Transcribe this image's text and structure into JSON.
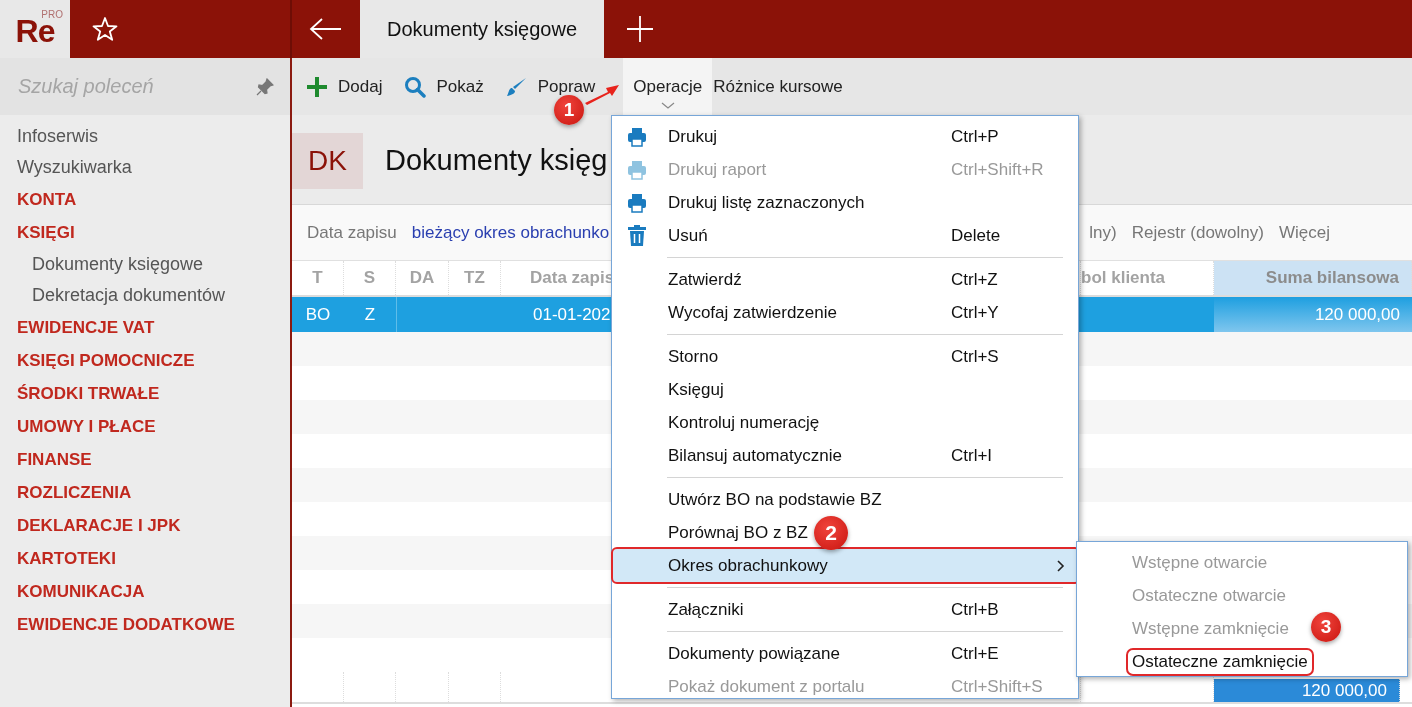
{
  "logo": {
    "text": "Re",
    "badge": "PRO"
  },
  "tabs": [
    {
      "label": "Dokumenty księgowe",
      "selected": true
    }
  ],
  "sidebar": {
    "search": {
      "placeholder": "Szukaj poleceń"
    },
    "items": [
      {
        "label": "Infoserwis",
        "kind": "link"
      },
      {
        "label": "Wyszukiwarka",
        "kind": "link"
      },
      {
        "label": "KONTA",
        "kind": "section"
      },
      {
        "label": "KSIĘGI",
        "kind": "section",
        "children": [
          {
            "label": "Dokumenty księgowe",
            "kind": "link"
          },
          {
            "label": "Dekretacja dokumentów",
            "kind": "link"
          }
        ]
      },
      {
        "label": "EWIDENCJE VAT",
        "kind": "section"
      },
      {
        "label": "KSIĘGI POMOCNICZE",
        "kind": "section"
      },
      {
        "label": "ŚRODKI TRWAŁE",
        "kind": "section"
      },
      {
        "label": "UMOWY I PŁACE",
        "kind": "section"
      },
      {
        "label": "FINANSE",
        "kind": "section"
      },
      {
        "label": "ROZLICZENIA",
        "kind": "section"
      },
      {
        "label": "DEKLARACJE I JPK",
        "kind": "section"
      },
      {
        "label": "KARTOTEKI",
        "kind": "section"
      },
      {
        "label": "KOMUNIKACJA",
        "kind": "section"
      },
      {
        "label": "EWIDENCJE DODATKOWE",
        "kind": "section"
      }
    ]
  },
  "toolbar": [
    {
      "label": "Dodaj",
      "kind": "add",
      "selected": false
    },
    {
      "label": "Pokaż",
      "kind": "show",
      "selected": false
    },
    {
      "label": "Popraw",
      "kind": "edit",
      "selected": false
    },
    {
      "label": "Operacje",
      "kind": "menu",
      "selected": true,
      "marker": "1"
    },
    {
      "label": "Różnice kursowe",
      "kind": "plain",
      "selected": false
    }
  ],
  "header": {
    "badge": "DK",
    "title": "Dokumenty księg"
  },
  "filters": [
    {
      "text": "Data zapisu",
      "kind": "label"
    },
    {
      "text": "bieżący okres obrachunko",
      "kind": "value"
    },
    {
      "text": "lny)",
      "kind": "label"
    },
    {
      "text": "Rejestr (dowolny)",
      "kind": "label"
    },
    {
      "text": "Więcej",
      "kind": "label"
    }
  ],
  "table": {
    "columns": [
      {
        "label": "T",
        "selected": false
      },
      {
        "label": "S",
        "selected": false
      },
      {
        "label": "DA",
        "selected": false
      },
      {
        "label": "TZ",
        "selected": false
      },
      {
        "label": "Data zapis",
        "selected": false
      },
      {
        "label": "bol klienta",
        "selected": false
      },
      {
        "label": "Suma bilansowa",
        "selected": true
      }
    ],
    "rows": [
      {
        "selected": true,
        "cells": [
          "BO",
          "Z",
          null,
          null,
          "01-01-202",
          null,
          "120 000,00"
        ]
      }
    ],
    "footer": {
      "sum": "120 000,00"
    }
  },
  "menu": {
    "items": [
      {
        "kind": "print",
        "label": "Drukuj",
        "shortcut": "Ctrl+P",
        "disabled": false,
        "selected": false,
        "annotated": false
      },
      {
        "kind": "print",
        "label": "Drukuj raport",
        "shortcut": "Ctrl+Shift+R",
        "disabled": true,
        "selected": false,
        "annotated": false
      },
      {
        "kind": "print",
        "label": "Drukuj listę zaznaczonych",
        "disabled": false,
        "selected": false,
        "annotated": false
      },
      {
        "kind": "delete",
        "label": "Usuń",
        "shortcut": "Delete",
        "disabled": false,
        "selected": false,
        "annotated": false
      },
      {
        "kind": "separator"
      },
      {
        "kind": "item",
        "label": "Zatwierdź",
        "shortcut": "Ctrl+Z",
        "disabled": false,
        "selected": false,
        "annotated": false
      },
      {
        "kind": "item",
        "label": "Wycofaj zatwierdzenie",
        "shortcut": "Ctrl+Y",
        "disabled": false,
        "selected": false,
        "annotated": false
      },
      {
        "kind": "separator"
      },
      {
        "kind": "item",
        "label": "Storno",
        "shortcut": "Ctrl+S",
        "disabled": false,
        "selected": false,
        "annotated": false
      },
      {
        "kind": "item",
        "label": "Księguj",
        "disabled": false,
        "selected": false,
        "annotated": false
      },
      {
        "kind": "item",
        "label": "Kontroluj numerację",
        "disabled": false,
        "selected": false,
        "annotated": false
      },
      {
        "kind": "item",
        "label": "Bilansuj automatycznie",
        "shortcut": "Ctrl+I",
        "disabled": false,
        "selected": false,
        "annotated": false
      },
      {
        "kind": "separator"
      },
      {
        "kind": "item",
        "label": "Utwórz BO na podstawie BZ",
        "disabled": false,
        "selected": false,
        "annotated": false
      },
      {
        "kind": "item",
        "label": "Porównaj BO z BZ",
        "disabled": false,
        "selected": false,
        "annotated": false,
        "marker": "2"
      },
      {
        "kind": "submenu",
        "label": "Okres obrachunkowy",
        "disabled": false,
        "selected": true,
        "annotated": true
      },
      {
        "kind": "separator"
      },
      {
        "kind": "item",
        "label": "Załączniki",
        "shortcut": "Ctrl+B",
        "disabled": false,
        "selected": false,
        "annotated": false
      },
      {
        "kind": "separator"
      },
      {
        "kind": "item",
        "label": "Dokumenty powiązane",
        "shortcut": "Ctrl+E",
        "disabled": false,
        "selected": false,
        "annotated": false
      },
      {
        "kind": "item",
        "label": "Pokaż dokument z portalu",
        "shortcut": "Ctrl+Shift+S",
        "disabled": true,
        "selected": false,
        "annotated": false
      }
    ]
  },
  "submenu": {
    "items": [
      {
        "label": "Wstępne otwarcie",
        "disabled": true,
        "annotated": false
      },
      {
        "label": "Ostateczne otwarcie",
        "disabled": true,
        "annotated": false
      },
      {
        "label": "Wstępne zamknięcie",
        "disabled": true,
        "annotated": false,
        "marker": "3"
      },
      {
        "label": "Ostateczne zamknięcie",
        "disabled": false,
        "annotated": true
      }
    ]
  }
}
